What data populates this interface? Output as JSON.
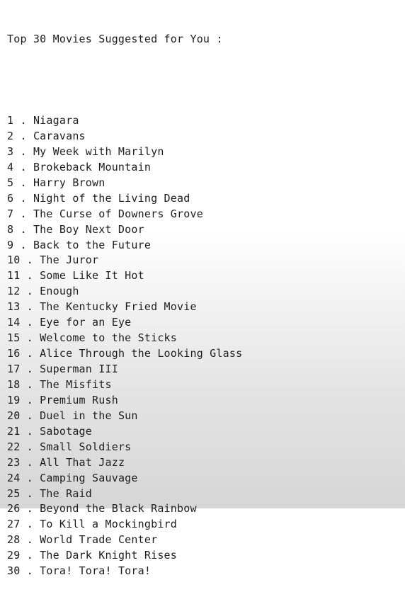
{
  "output": {
    "title": "Top 30 Movies Suggested for You :",
    "movies": [
      {
        "number": "1",
        "separator": " . ",
        "title": "Niagara"
      },
      {
        "number": "2",
        "separator": " . ",
        "title": "Caravans"
      },
      {
        "number": "3",
        "separator": " . ",
        "title": "My Week with Marilyn"
      },
      {
        "number": "4",
        "separator": " . ",
        "title": "Brokeback Mountain"
      },
      {
        "number": "5",
        "separator": " . ",
        "title": "Harry Brown"
      },
      {
        "number": "6",
        "separator": " . ",
        "title": "Night of the Living Dead"
      },
      {
        "number": "7",
        "separator": " . ",
        "title": "The Curse of Downers Grove"
      },
      {
        "number": "8",
        "separator": " . ",
        "title": "The Boy Next Door"
      },
      {
        "number": "9",
        "separator": " . ",
        "title": "Back to the Future"
      },
      {
        "number": "10",
        "separator": " . ",
        "title": "The Juror"
      },
      {
        "number": "11",
        "separator": " . ",
        "title": "Some Like It Hot"
      },
      {
        "number": "12",
        "separator": " . ",
        "title": "Enough"
      },
      {
        "number": "13",
        "separator": " . ",
        "title": "The Kentucky Fried Movie"
      },
      {
        "number": "14",
        "separator": " . ",
        "title": "Eye for an Eye"
      },
      {
        "number": "15",
        "separator": " . ",
        "title": "Welcome to the Sticks"
      },
      {
        "number": "16",
        "separator": " . ",
        "title": "Alice Through the Looking Glass"
      },
      {
        "number": "17",
        "separator": " . ",
        "title": "Superman III"
      },
      {
        "number": "18",
        "separator": " . ",
        "title": "The Misfits"
      },
      {
        "number": "19",
        "separator": " . ",
        "title": "Premium Rush"
      },
      {
        "number": "20",
        "separator": " . ",
        "title": "Duel in the Sun"
      },
      {
        "number": "21",
        "separator": " . ",
        "title": "Sabotage"
      },
      {
        "number": "22",
        "separator": " . ",
        "title": "Small Soldiers"
      },
      {
        "number": "23",
        "separator": " . ",
        "title": "All That Jazz"
      },
      {
        "number": "24",
        "separator": " . ",
        "title": "Camping Sauvage"
      },
      {
        "number": "25",
        "separator": " . ",
        "title": "The Raid"
      },
      {
        "number": "26",
        "separator": " . ",
        "title": "Beyond the Black Rainbow"
      },
      {
        "number": "27",
        "separator": " . ",
        "title": "To Kill a Mockingbird"
      },
      {
        "number": "28",
        "separator": " . ",
        "title": "World Trade Center"
      },
      {
        "number": "29",
        "separator": " . ",
        "title": "The Dark Knight Rises"
      },
      {
        "number": "30",
        "separator": " . ",
        "title": "Tora! Tora! Tora!"
      }
    ]
  }
}
